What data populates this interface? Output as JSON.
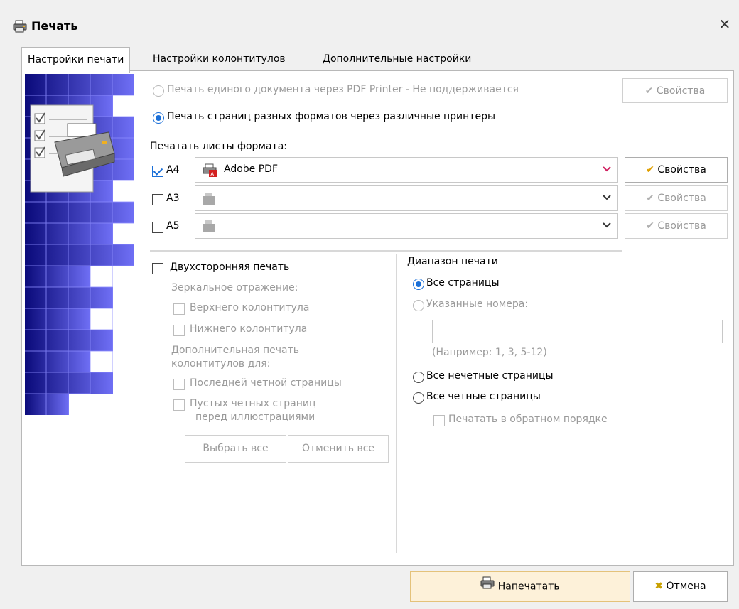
{
  "window": {
    "title": "Печать",
    "close_glyph": "✕"
  },
  "tabs": [
    {
      "label": "Настройки печати",
      "active": true
    },
    {
      "label": "Настройки колонтитулов",
      "active": false
    },
    {
      "label": "Дополнительные настройки",
      "active": false
    }
  ],
  "print_mode": {
    "pdf_option": {
      "label": "Печать единого документа через PDF Printer - Не поддерживается",
      "checked": false,
      "enabled": false
    },
    "multi_option": {
      "label": "Печать страниц разных форматов через различные принтеры",
      "checked": true,
      "enabled": true
    }
  },
  "formats": {
    "heading": "Печатать листы формата:",
    "rows": [
      {
        "format": "A4",
        "checked": true,
        "printer": "Adobe PDF",
        "properties_label": "Свойства",
        "properties_enabled": true
      },
      {
        "format": "A3",
        "checked": false,
        "printer": "",
        "properties_label": "Свойства",
        "properties_enabled": false
      },
      {
        "format": "A5",
        "checked": false,
        "printer": "",
        "properties_label": "Свойства",
        "properties_enabled": false
      }
    ]
  },
  "properties_top": {
    "label": "Свойства",
    "enabled": false
  },
  "duplex": {
    "label": "Двухсторонняя печать",
    "checked": false,
    "mirror_heading": "Зеркальное отражение:",
    "mirror_header": "Верхнего колонтитула",
    "mirror_footer": "Нижнего колонтитула",
    "extra_heading_line1": "Дополнительная печать",
    "extra_heading_line2": "колонтитулов для:",
    "last_even": "Последней четной страницы",
    "empty_even_line1": "Пустых четных страниц",
    "empty_even_line2": "перед иллюстрациями",
    "select_all": "Выбрать все",
    "deselect_all": "Отменить все"
  },
  "range": {
    "heading": "Диапазон печати",
    "all_pages": "Все страницы",
    "specified": "Указанные номера:",
    "specified_value": "",
    "example": "(Например: 1, 3, 5-12)",
    "odd_pages": "Все нечетные страницы",
    "even_pages": "Все четные страницы",
    "reverse": "Печатать в обратном порядке",
    "selected": "all_pages"
  },
  "footer": {
    "print_label": "Напечатать",
    "cancel_label": "Отмена"
  },
  "colors": {
    "accent": "#1a6fd8",
    "banner_dark": "#0a0a7a",
    "banner_light": "#6f6ff5",
    "primary_button": "#fdf1d9"
  },
  "icons": [
    "printer-icon",
    "close-icon",
    "pdf-printer-icon",
    "check-mark-icon",
    "cancel-x-icon",
    "chevron-down-icon"
  ]
}
